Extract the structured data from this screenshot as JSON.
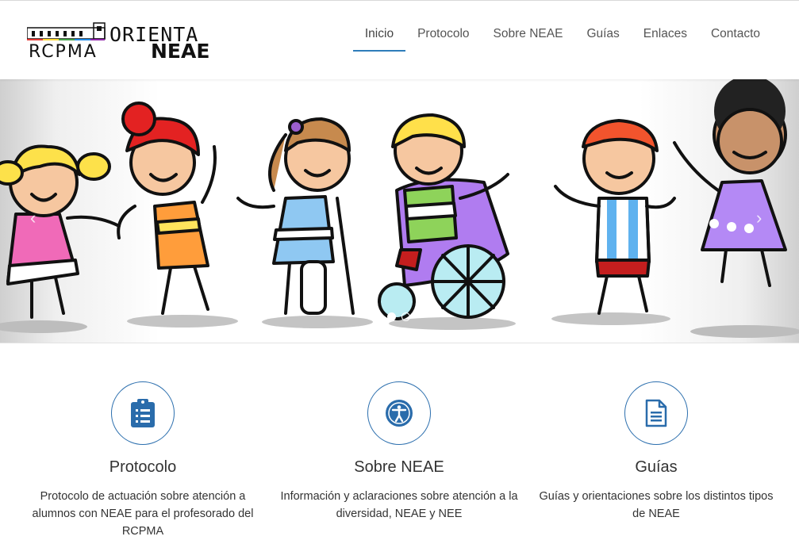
{
  "brand": {
    "line1": "ORIENTA",
    "line2": "NEAE",
    "line3": "RCPMA"
  },
  "nav": [
    {
      "label": "Inicio",
      "active": true
    },
    {
      "label": "Protocolo"
    },
    {
      "label": "Sobre NEAE"
    },
    {
      "label": "Guías"
    },
    {
      "label": "Enlaces"
    },
    {
      "label": "Contacto"
    }
  ],
  "carousel": {
    "slides": 2,
    "active_slide": 1
  },
  "features": [
    {
      "title": "Protocolo",
      "icon": "clipboard-list-icon",
      "text": "Protocolo de actuación sobre atención a alumnos con NEAE para el profesorado del RCPMA"
    },
    {
      "title": "Sobre NEAE",
      "icon": "accessibility-icon",
      "text": "Información y aclaraciones sobre atención a la diversidad, NEAE y NEE"
    },
    {
      "title": "Guías",
      "icon": "document-icon",
      "text": "Guías y orientaciones sobre los distintos tipos de NEAE"
    }
  ],
  "colors": {
    "accent": "#2e7dba",
    "icon": "#2a6cab"
  }
}
